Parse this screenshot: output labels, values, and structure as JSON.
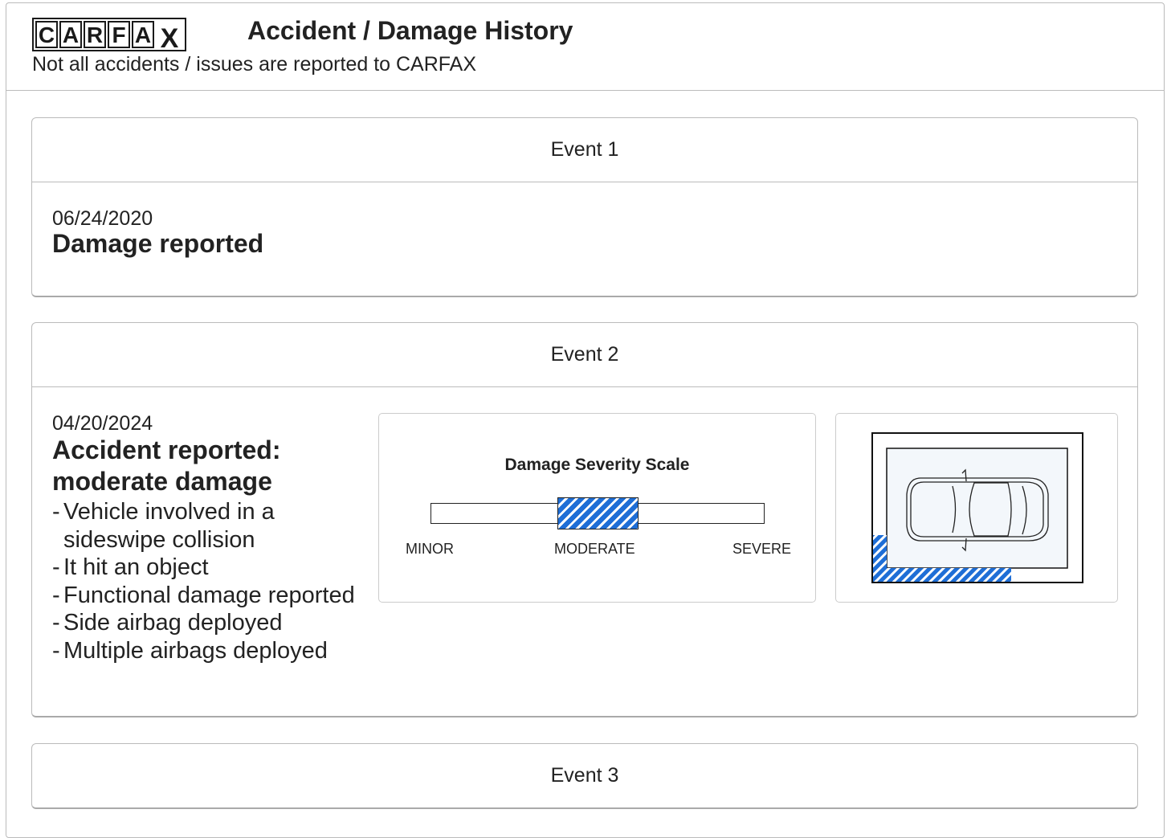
{
  "header": {
    "logo_letters": [
      "C",
      "A",
      "R",
      "F",
      "A",
      "X"
    ],
    "title": "Accident / Damage History",
    "subtitle": "Not all accidents / issues are reported to CARFAX"
  },
  "events": [
    {
      "heading": "Event 1",
      "date": "06/24/2020",
      "title": "Damage reported"
    },
    {
      "heading": "Event 2",
      "date": "04/20/2024",
      "title_line1": "Accident reported:",
      "title_line2": "moderate damage",
      "details": [
        "Vehicle involved in a sideswipe collision",
        "It hit an object",
        "Functional damage reported",
        "Side airbag deployed",
        "Multiple airbags deployed"
      ],
      "severity": {
        "title": "Damage Severity Scale",
        "labels": [
          "MINOR",
          "MODERATE",
          "SEVERE"
        ],
        "level": "MODERATE"
      },
      "damage_diagram": {
        "icon": "car-top-view-icon",
        "damaged_area": "left-rear"
      }
    },
    {
      "heading": "Event 3"
    }
  ],
  "colors": {
    "damage_blue": "#1e6ed6",
    "border": "#bbbbbb",
    "text": "#222222"
  }
}
